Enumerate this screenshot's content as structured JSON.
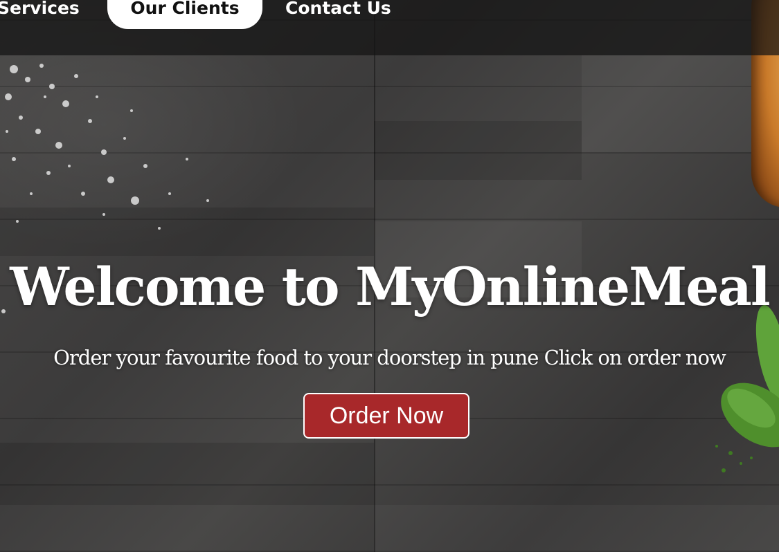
{
  "nav": {
    "items": [
      {
        "label": "Services",
        "active": false
      },
      {
        "label": "Our Clients",
        "active": true
      },
      {
        "label": "Contact Us",
        "active": false
      }
    ]
  },
  "hero": {
    "title": "Welcome to MyOnlineMeal",
    "subtitle": "Order your favourite food to your doorstep in pune Click on order now",
    "cta_label": "Order Now"
  },
  "colors": {
    "cta_background": "#a8282a",
    "nav_active_background": "#ffffff",
    "text": "#ffffff"
  }
}
